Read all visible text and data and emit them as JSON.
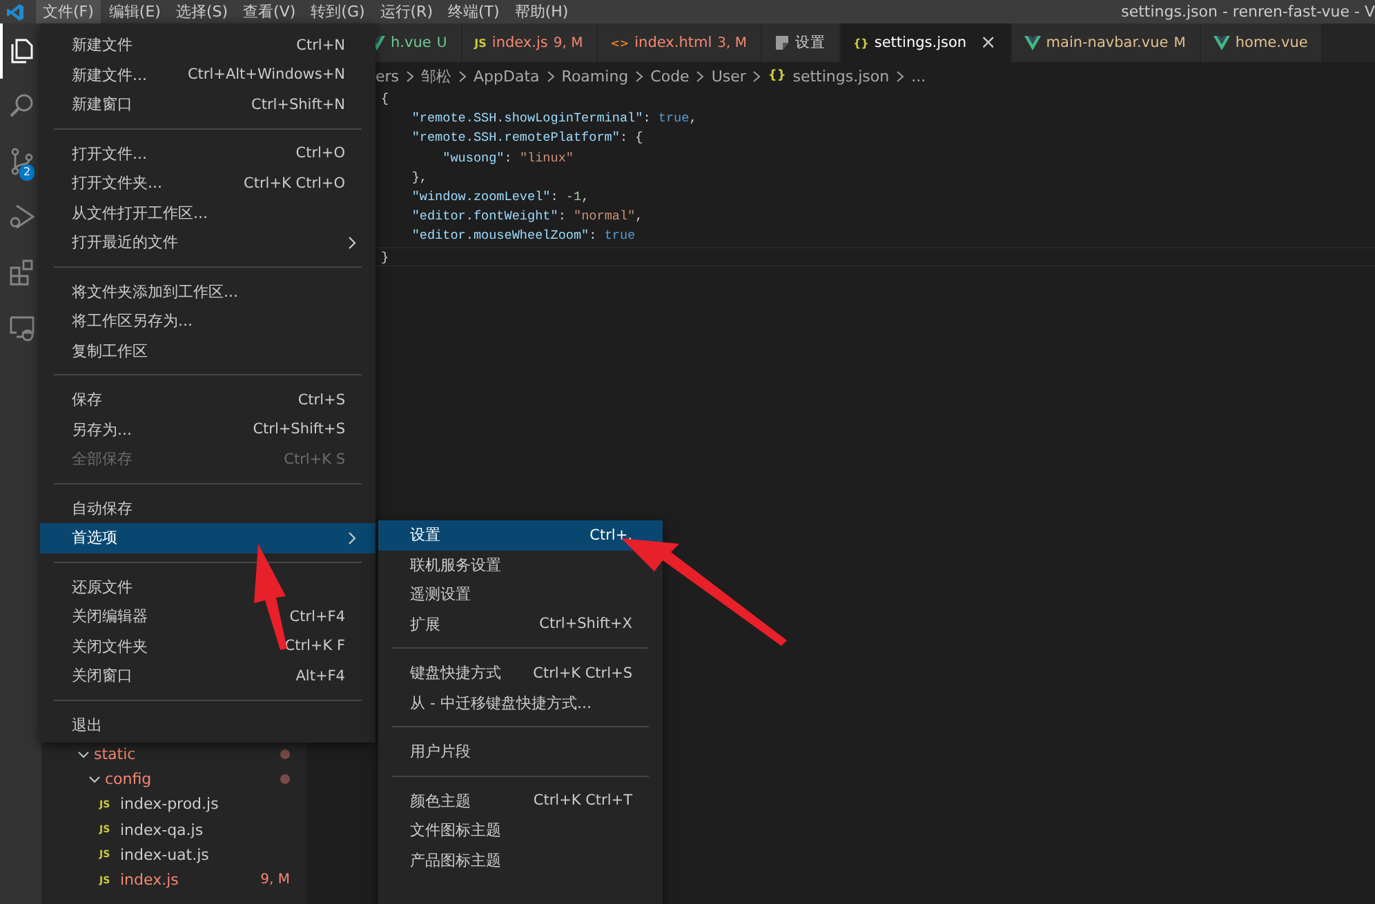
{
  "title_bar": {
    "title": "settings.json - renren-fast-vue - V"
  },
  "menu_bar": [
    {
      "label": "文件(F)",
      "selected": true
    },
    {
      "label": "编辑(E)",
      "selected": false
    },
    {
      "label": "选择(S)",
      "selected": false
    },
    {
      "label": "查看(V)",
      "selected": false
    },
    {
      "label": "转到(G)",
      "selected": false
    },
    {
      "label": "运行(R)",
      "selected": false
    },
    {
      "label": "终端(T)",
      "selected": false
    },
    {
      "label": "帮助(H)",
      "selected": false
    }
  ],
  "activity_bar": [
    {
      "kind": "explorer",
      "selected": true
    },
    {
      "kind": "search",
      "selected": false
    },
    {
      "kind": "source-control",
      "selected": false,
      "badge": "2"
    },
    {
      "kind": "debug",
      "selected": false
    },
    {
      "kind": "extensions",
      "selected": false
    },
    {
      "kind": "remote",
      "selected": false
    }
  ],
  "tabs": [
    {
      "kind": "vue",
      "label": "h.vue",
      "badge": "U",
      "color": "#73c991",
      "selected": false
    },
    {
      "kind": "text-icon",
      "icon": "JS",
      "label": "index.js",
      "badge": "9, M",
      "color": "#f48771",
      "selected": false
    },
    {
      "kind": "text-icon",
      "icon": "<>",
      "label": "index.html",
      "badge": "3, M",
      "color": "#f48771",
      "selected": false
    },
    {
      "kind": "settings",
      "label": "设置",
      "color": "#cccccc",
      "selected": false
    },
    {
      "kind": "text-icon",
      "icon": "{}",
      "label": "settings.json",
      "color": "#ffffff",
      "selected": true,
      "close": "×"
    },
    {
      "kind": "vue",
      "label": "main-navbar.vue",
      "badge": "M",
      "color": "#e2c08d",
      "selected": false
    },
    {
      "kind": "vue",
      "label": "home.vue",
      "color": "#e2c08d",
      "selected": false
    }
  ],
  "breadcrumb": [
    {
      "label": "ers"
    },
    {
      "label": "邹松"
    },
    {
      "label": "AppData"
    },
    {
      "label": "Roaming"
    },
    {
      "label": "Code"
    },
    {
      "label": "User"
    },
    {
      "label": "settings.json",
      "icon": "{}"
    },
    {
      "label": "..."
    }
  ],
  "code_lines": [
    {
      "tokens": [
        {
          "kind": "punct",
          "t": "{"
        }
      ]
    },
    {
      "tokens": [
        {
          "kind": "key",
          "t": "    \"remote.SSH.showLoginTerminal\""
        },
        {
          "kind": "punct",
          "t": ": "
        },
        {
          "kind": "keyword",
          "t": "true"
        },
        {
          "kind": "punct",
          "t": ","
        }
      ]
    },
    {
      "tokens": [
        {
          "kind": "key",
          "t": "    \"remote.SSH.remotePlatform\""
        },
        {
          "kind": "punct",
          "t": ": {"
        }
      ]
    },
    {
      "tokens": [
        {
          "kind": "key",
          "t": "        \"wusong\""
        },
        {
          "kind": "punct",
          "t": ": "
        },
        {
          "kind": "string",
          "t": "\"linux\""
        }
      ]
    },
    {
      "tokens": [
        {
          "kind": "punct",
          "t": "    },"
        }
      ]
    },
    {
      "tokens": [
        {
          "kind": "key",
          "t": "    \"window.zoomLevel\""
        },
        {
          "kind": "punct",
          "t": ": "
        },
        {
          "kind": "number",
          "t": "-1"
        },
        {
          "kind": "punct",
          "t": ","
        }
      ]
    },
    {
      "tokens": [
        {
          "kind": "key",
          "t": "    \"editor.fontWeight\""
        },
        {
          "kind": "punct",
          "t": ": "
        },
        {
          "kind": "string",
          "t": "\"normal\""
        },
        {
          "kind": "punct",
          "t": ","
        }
      ]
    },
    {
      "tokens": [
        {
          "kind": "key",
          "t": "    \"editor.mouseWheelZoom\""
        },
        {
          "kind": "punct",
          "t": ": "
        },
        {
          "kind": "keyword",
          "t": "true"
        }
      ]
    },
    {
      "current": true,
      "tokens": [
        {
          "kind": "punct",
          "t": "}"
        }
      ]
    }
  ],
  "explorer_tree": [
    {
      "label": "static",
      "color": "#f48771",
      "modified": true,
      "expanded": true,
      "children": [
        {
          "label": "config",
          "color": "#f48771",
          "modified": true,
          "expanded": true,
          "children": [
            {
              "icon": "JS",
              "label": "index-prod.js",
              "color": "#cccccc"
            },
            {
              "icon": "JS",
              "label": "index-qa.js",
              "color": "#cccccc"
            },
            {
              "icon": "JS",
              "label": "index-uat.js",
              "color": "#cccccc"
            },
            {
              "icon": "JS",
              "label": "index.js",
              "color": "#f48771",
              "badge": "9, M"
            }
          ]
        }
      ]
    }
  ],
  "file_menu": [
    [
      {
        "label": "新建文件",
        "shortcut": "Ctrl+N"
      },
      {
        "label": "新建文件...",
        "shortcut": "Ctrl+Alt+Windows+N"
      },
      {
        "label": "新建窗口",
        "shortcut": "Ctrl+Shift+N"
      }
    ],
    [
      {
        "label": "打开文件...",
        "shortcut": "Ctrl+O"
      },
      {
        "label": "打开文件夹...",
        "shortcut": "Ctrl+K Ctrl+O"
      },
      {
        "label": "从文件打开工作区..."
      },
      {
        "label": "打开最近的文件",
        "submenu": true
      }
    ],
    [
      {
        "label": "将文件夹添加到工作区..."
      },
      {
        "label": "将工作区另存为..."
      },
      {
        "label": "复制工作区"
      }
    ],
    [
      {
        "label": "保存",
        "shortcut": "Ctrl+S"
      },
      {
        "label": "另存为...",
        "shortcut": "Ctrl+Shift+S"
      },
      {
        "label": "全部保存",
        "shortcut": "Ctrl+K S",
        "disabled": true
      }
    ],
    [
      {
        "label": "自动保存"
      },
      {
        "label": "首选项",
        "submenu": true,
        "selected": true
      }
    ],
    [
      {
        "label": "还原文件"
      },
      {
        "label": "关闭编辑器",
        "shortcut": "Ctrl+F4"
      },
      {
        "label": "关闭文件夹",
        "shortcut": "Ctrl+K F"
      },
      {
        "label": "关闭窗口",
        "shortcut": "Alt+F4"
      }
    ],
    [
      {
        "label": "退出"
      }
    ]
  ],
  "preferences_submenu": [
    [
      {
        "label": "设置",
        "shortcut": "Ctrl+,",
        "selected": true
      },
      {
        "label": "联机服务设置"
      },
      {
        "label": "遥测设置"
      },
      {
        "label": "扩展",
        "shortcut": "Ctrl+Shift+X"
      }
    ],
    [
      {
        "label": "键盘快捷方式",
        "shortcut": "Ctrl+K Ctrl+S"
      },
      {
        "label": "从 - 中迁移键盘快捷方式..."
      }
    ],
    [
      {
        "label": "用户片段"
      }
    ],
    [
      {
        "label": "颜色主题",
        "shortcut": "Ctrl+K Ctrl+T"
      },
      {
        "label": "文件图标主题"
      },
      {
        "label": "产品图标主题"
      }
    ]
  ],
  "annotations": [
    {
      "kind": "arrow"
    },
    {
      "kind": "arrow"
    }
  ]
}
